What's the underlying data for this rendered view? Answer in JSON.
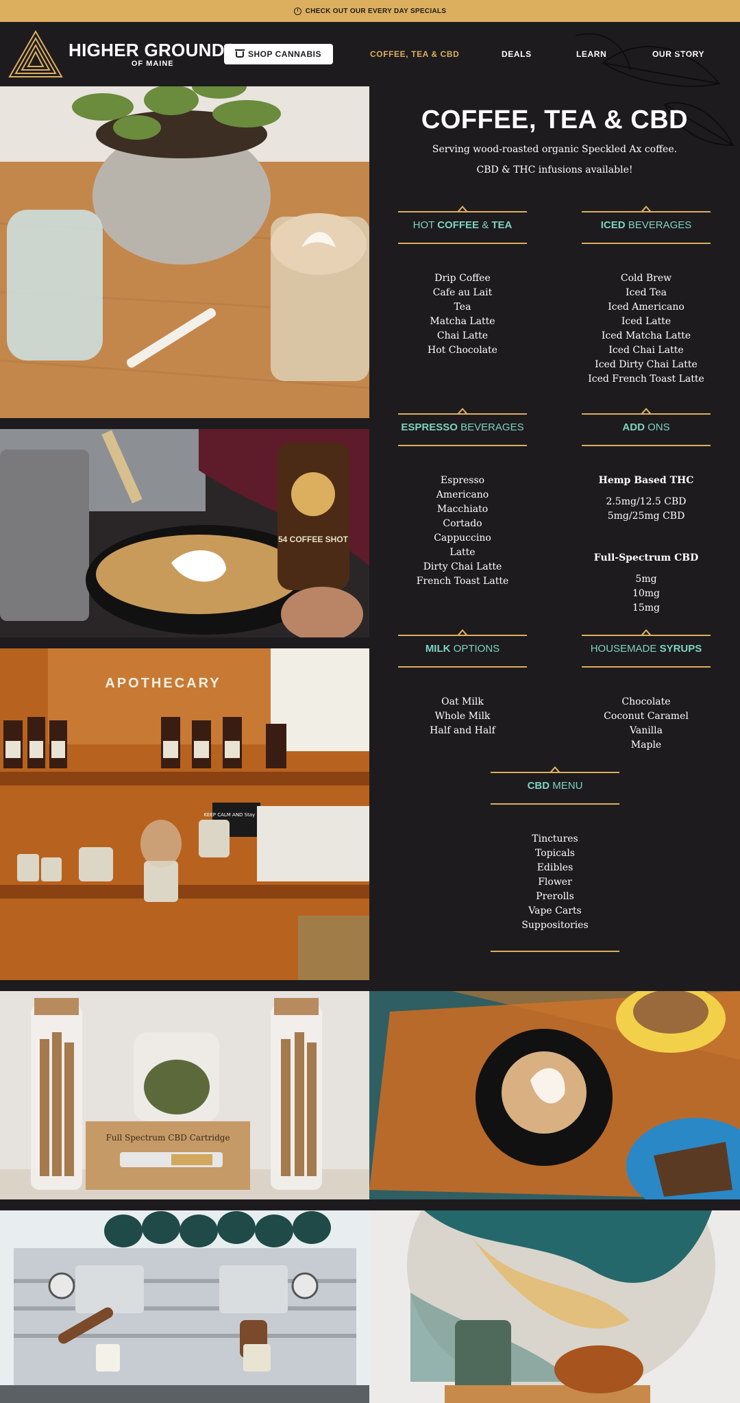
{
  "topbar": {
    "text": "CHECK OUT OUR EVERY DAY SPECIALS"
  },
  "header": {
    "logo_line1": "HIGHER GROUNDS",
    "logo_line2": "OF MAINE",
    "shop_button": "SHOP CANNABIS",
    "nav": [
      "COFFEE, TEA & CBD",
      "DEALS",
      "LEARN",
      "OUR STORY"
    ]
  },
  "main": {
    "title": "COFFEE, TEA & CBD",
    "subtitle1": "Serving wood-roasted organic Speckled Ax coffee.",
    "subtitle2": "CBD & THC infusions available!"
  },
  "sections": {
    "hot": {
      "pre": "HOT ",
      "b1": "COFFEE",
      "mid": " & ",
      "b2": "TEA",
      "items": [
        "Drip Coffee",
        "Cafe au Lait",
        "Tea",
        "Matcha Latte",
        "Chai Latte",
        "Hot Chocolate"
      ]
    },
    "iced": {
      "b1": "ICED",
      "post": " BEVERAGES",
      "items": [
        "Cold Brew",
        "Iced Tea",
        "Iced Americano",
        "Iced Latte",
        "Iced Matcha Latte",
        "Iced Chai Latte",
        "Iced Dirty Chai Latte",
        "Iced French Toast Latte"
      ]
    },
    "espresso": {
      "b1": "ESPRESSO",
      "post": " BEVERAGES",
      "items": [
        "Espresso",
        "Americano",
        "Macchiato",
        "Cortado",
        "Cappuccino",
        "Latte",
        "Dirty Chai Latte",
        "French Toast Latte"
      ]
    },
    "addons": {
      "b1": "ADD",
      "post": " ONS",
      "thc_heading": "Hemp Based THC",
      "thc_items": [
        "2.5mg/12.5 CBD",
        "5mg/25mg CBD"
      ],
      "cbd_heading": "Full-Spectrum CBD",
      "cbd_items": [
        "5mg",
        "10mg",
        "15mg"
      ]
    },
    "milk": {
      "b1": "MILK",
      "post": " OPTIONS",
      "items": [
        "Oat Milk",
        "Whole Milk",
        "Half and Half"
      ]
    },
    "syrups": {
      "pre": "HOUSEMADE ",
      "b1": "SYRUPS",
      "items": [
        "Chocolate",
        "Coconut Caramel",
        "Vanilla",
        "Maple"
      ]
    },
    "cbd": {
      "b1": "CBD",
      "post": " MENU",
      "items": [
        "Tinctures",
        "Topicals",
        "Edibles",
        "Flower",
        "Prerolls",
        "Vape Carts",
        "Suppositories"
      ]
    }
  },
  "photos": {
    "apothecary_sign": "APOTHECARY",
    "bottle_label": "54 COFFEE SHOT",
    "chalkboard": "KEEP CALM AND Stay Local",
    "cartridge_box": "Full Spectrum CBD Cartridge"
  },
  "colors": {
    "accent": "#dcaf5e",
    "teal": "#7fd3c0",
    "background": "#1d1b1e"
  }
}
